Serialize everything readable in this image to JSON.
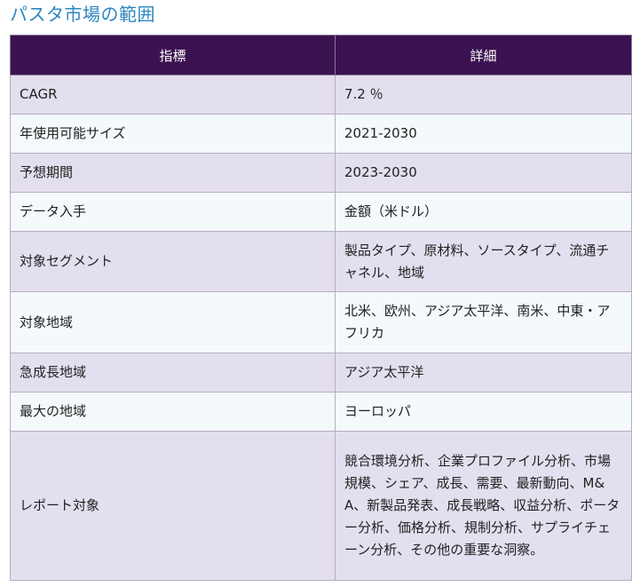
{
  "title": "パスタ市場の範囲",
  "table": {
    "headers": [
      "指標",
      "詳細"
    ],
    "rows": [
      {
        "label": "CAGR",
        "value": "7.2 ％"
      },
      {
        "label": "年使用可能サイズ",
        "value": "2021-2030"
      },
      {
        "label": "予想期間",
        "value": "2023-2030"
      },
      {
        "label": "データ入手",
        "value": "金額（米ドル）"
      },
      {
        "label": "対象セグメント",
        "value": "製品タイプ、原材料、ソースタイプ、流通チャネル、地域"
      },
      {
        "label": "対象地域",
        "value": "北米、欧州、アジア太平洋、南米、中東・アフリカ"
      },
      {
        "label": "急成長地域",
        "value": "アジア太平洋"
      },
      {
        "label": "最大の地域",
        "value": "ヨーロッパ"
      },
      {
        "label": "レポート対象",
        "value": "競合環境分析、企業プロファイル分析、市場規模、シェア、成長、需要、最新動向、M&A、新製品発表、成長戦略、収益分析、ポーター分析、価格分析、規制分析、サプライチェーン分析、その他の重要な洞察。"
      }
    ]
  }
}
